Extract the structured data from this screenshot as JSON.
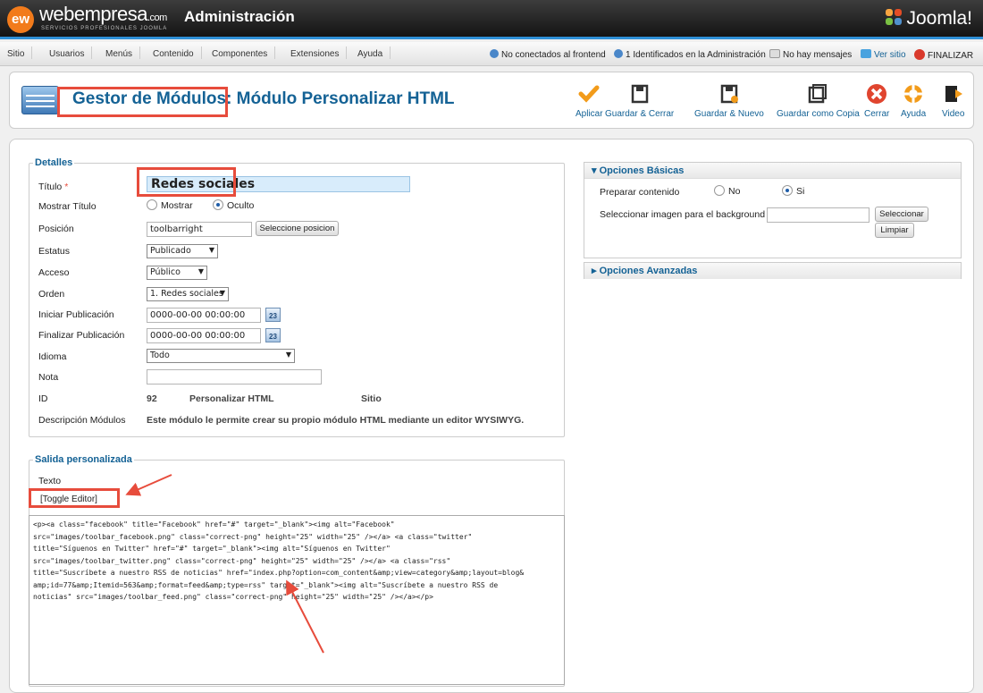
{
  "header": {
    "brand": "webempresa",
    "brand_suffix": ".com",
    "brand_sub": "SERVICIOS PROFESIONALES JOOMLA",
    "logo_mark": "ew",
    "title": "Administración",
    "product_logo": "Joomla!"
  },
  "menu": [
    "Sitio",
    "Usuarios",
    "Menús",
    "Contenido",
    "Componentes",
    "Extensiones",
    "Ayuda"
  ],
  "status": {
    "frontend": "No conectados al frontend",
    "admin": "1 Identificados en la Administración",
    "messages": "No hay mensajes",
    "view_site": "Ver sitio",
    "logout": "FINALIZAR"
  },
  "page": {
    "title_part1": "Gestor de Módulos",
    "title_part2": ": Módulo Personalizar HTML"
  },
  "toolbar": [
    {
      "label": "Aplicar",
      "icon": "check-icon"
    },
    {
      "label": "Guardar & Cerrar",
      "icon": "save-close-icon"
    },
    {
      "label": "Guardar & Nuevo",
      "icon": "save-new-icon"
    },
    {
      "label": "Guardar como Copia",
      "icon": "save-copy-icon"
    },
    {
      "label": "Cerrar",
      "icon": "close-icon"
    },
    {
      "label": "Ayuda",
      "icon": "help-icon"
    },
    {
      "label": "Video",
      "icon": "video-icon"
    }
  ],
  "details": {
    "legend": "Detalles",
    "title_label": "Título",
    "title_value": "Redes sociales",
    "required": "*",
    "show_title_label": "Mostrar Título",
    "show_opt": "Mostrar",
    "hide_opt": "Oculto",
    "position_label": "Posición",
    "position_value": "toolbarright",
    "position_button": "Seleccione posicion",
    "status_label": "Estatus",
    "status_value": "Publicado",
    "access_label": "Acceso",
    "access_value": "Público",
    "order_label": "Orden",
    "order_value": "1. Redes sociales",
    "start_label": "Iniciar Publicación",
    "start_value": "0000-00-00 00:00:00",
    "end_label": "Finalizar Publicación",
    "end_value": "0000-00-00 00:00:00",
    "calendar_day": "23",
    "language_label": "Idioma",
    "language_value": "Todo",
    "note_label": "Nota",
    "note_value": "",
    "id_label": "ID",
    "id_value": "92",
    "type_value": "Personalizar HTML",
    "site_value": "Sitio",
    "desc_label": "Descripción Módulos",
    "desc_value": "Este módulo le permite crear su propio módulo HTML mediante un editor WYSIWYG."
  },
  "output": {
    "legend": "Salida personalizada",
    "text_label": "Texto",
    "toggle": "[Toggle Editor]",
    "code": "<p><a class=\"facebook\" title=\"Facebook\" href=\"#\" target=\"_blank\"><img alt=\"Facebook\"\nsrc=\"images/toolbar_facebook.png\" class=\"correct-png\" height=\"25\" width=\"25\" /></a> <a class=\"twitter\"\ntitle=\"Síguenos en Twitter\" href=\"#\" target=\"_blank\"><img alt=\"Síguenos en Twitter\"\nsrc=\"images/toolbar_twitter.png\" class=\"correct-png\" height=\"25\" width=\"25\" /></a> <a class=\"rss\"\ntitle=\"Suscríbete a nuestro RSS de noticias\" href=\"index.php?option=com_content&amp;view=category&amp;layout=blog&\namp;id=77&amp;Itemid=563&amp;format=feed&amp;type=rss\" target=\"_blank\"><img alt=\"Suscríbete a nuestro RSS de\nnoticias\" src=\"images/toolbar_feed.png\" class=\"correct-png\" height=\"25\" width=\"25\" /></a></p>"
  },
  "basic": {
    "header": "Opciones Básicas",
    "prepare_label": "Preparar contenido",
    "no": "No",
    "yes": "Si",
    "bg_label": "Seleccionar imagen para el background",
    "bg_value": "",
    "select_btn": "Seleccionar",
    "clear_btn": "Limpiar"
  },
  "advanced": {
    "header": "Opciones Avanzadas"
  },
  "colors": {
    "accent": "#146295",
    "highlight": "#e74c3c",
    "brand_orange": "#f27b1b"
  }
}
